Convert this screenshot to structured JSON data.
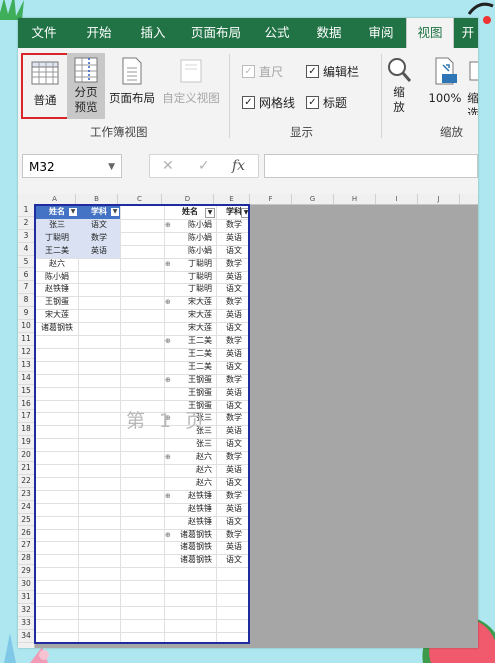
{
  "tabs": [
    "文件",
    "开始",
    "插入",
    "页面布局",
    "公式",
    "数据",
    "审阅",
    "视图",
    "开"
  ],
  "active_tab_index": 7,
  "ribbon": {
    "workbook_views": {
      "normal": "普通",
      "page_break_line1": "分页",
      "page_break_line2": "预览",
      "page_layout": "页面布局",
      "custom_view": "自定义视图",
      "group_label": "工作簿视图"
    },
    "show": {
      "ruler": "直尺",
      "formula_bar": "编辑栏",
      "gridlines": "网格线",
      "headings": "标题",
      "group_label": "显示"
    },
    "zoom": {
      "zoom_line1": "缩",
      "zoom_line2": "放",
      "zoom_100": "100%",
      "zoom_sel": "缩放",
      "zoom_sel_partial_line1": "缩",
      "zoom_sel_partial_line2": "选",
      "group_label": "缩放"
    }
  },
  "name_box": "M32",
  "fx_label": "fx",
  "col_headers": [
    "A",
    "B",
    "C",
    "D",
    "E",
    "F",
    "G",
    "H",
    "I",
    "J"
  ],
  "row_count": 34,
  "table1": {
    "headers": [
      "姓名",
      "学科"
    ],
    "names": [
      "张三",
      "丁聪明",
      "王二美",
      "赵六",
      "陈小娟",
      "赵铁锤",
      "王钢蛋",
      "宋大莲",
      "诸葛钢铁"
    ],
    "subjects": [
      "语文",
      "数学",
      "英语"
    ]
  },
  "table2": {
    "headers": [
      "姓名",
      "学科"
    ],
    "rows": [
      [
        "陈小娟",
        "数学"
      ],
      [
        "陈小娟",
        "英语"
      ],
      [
        "陈小娟",
        "语文"
      ],
      [
        "丁聪明",
        "数学"
      ],
      [
        "丁聪明",
        "英语"
      ],
      [
        "丁聪明",
        "语文"
      ],
      [
        "宋大莲",
        "数学"
      ],
      [
        "宋大莲",
        "英语"
      ],
      [
        "宋大莲",
        "语文"
      ],
      [
        "王二美",
        "数学"
      ],
      [
        "王二美",
        "英语"
      ],
      [
        "王二美",
        "语文"
      ],
      [
        "王钢蛋",
        "数学"
      ],
      [
        "王钢蛋",
        "英语"
      ],
      [
        "王钢蛋",
        "语文"
      ],
      [
        "张三",
        "数学"
      ],
      [
        "张三",
        "英语"
      ],
      [
        "张三",
        "语文"
      ],
      [
        "赵六",
        "数学"
      ],
      [
        "赵六",
        "英语"
      ],
      [
        "赵六",
        "语文"
      ],
      [
        "赵铁锤",
        "数学"
      ],
      [
        "赵铁锤",
        "英语"
      ],
      [
        "赵铁锤",
        "语文"
      ],
      [
        "诸葛钢铁",
        "数学"
      ],
      [
        "诸葛钢铁",
        "英语"
      ],
      [
        "诸葛钢铁",
        "语文"
      ]
    ]
  },
  "watermark": "第 1 页",
  "colors": {
    "excel_green": "#217346",
    "page_border": "#1f2b9e",
    "header_blue": "#4472c4",
    "highlight_red": "#d9262a"
  }
}
